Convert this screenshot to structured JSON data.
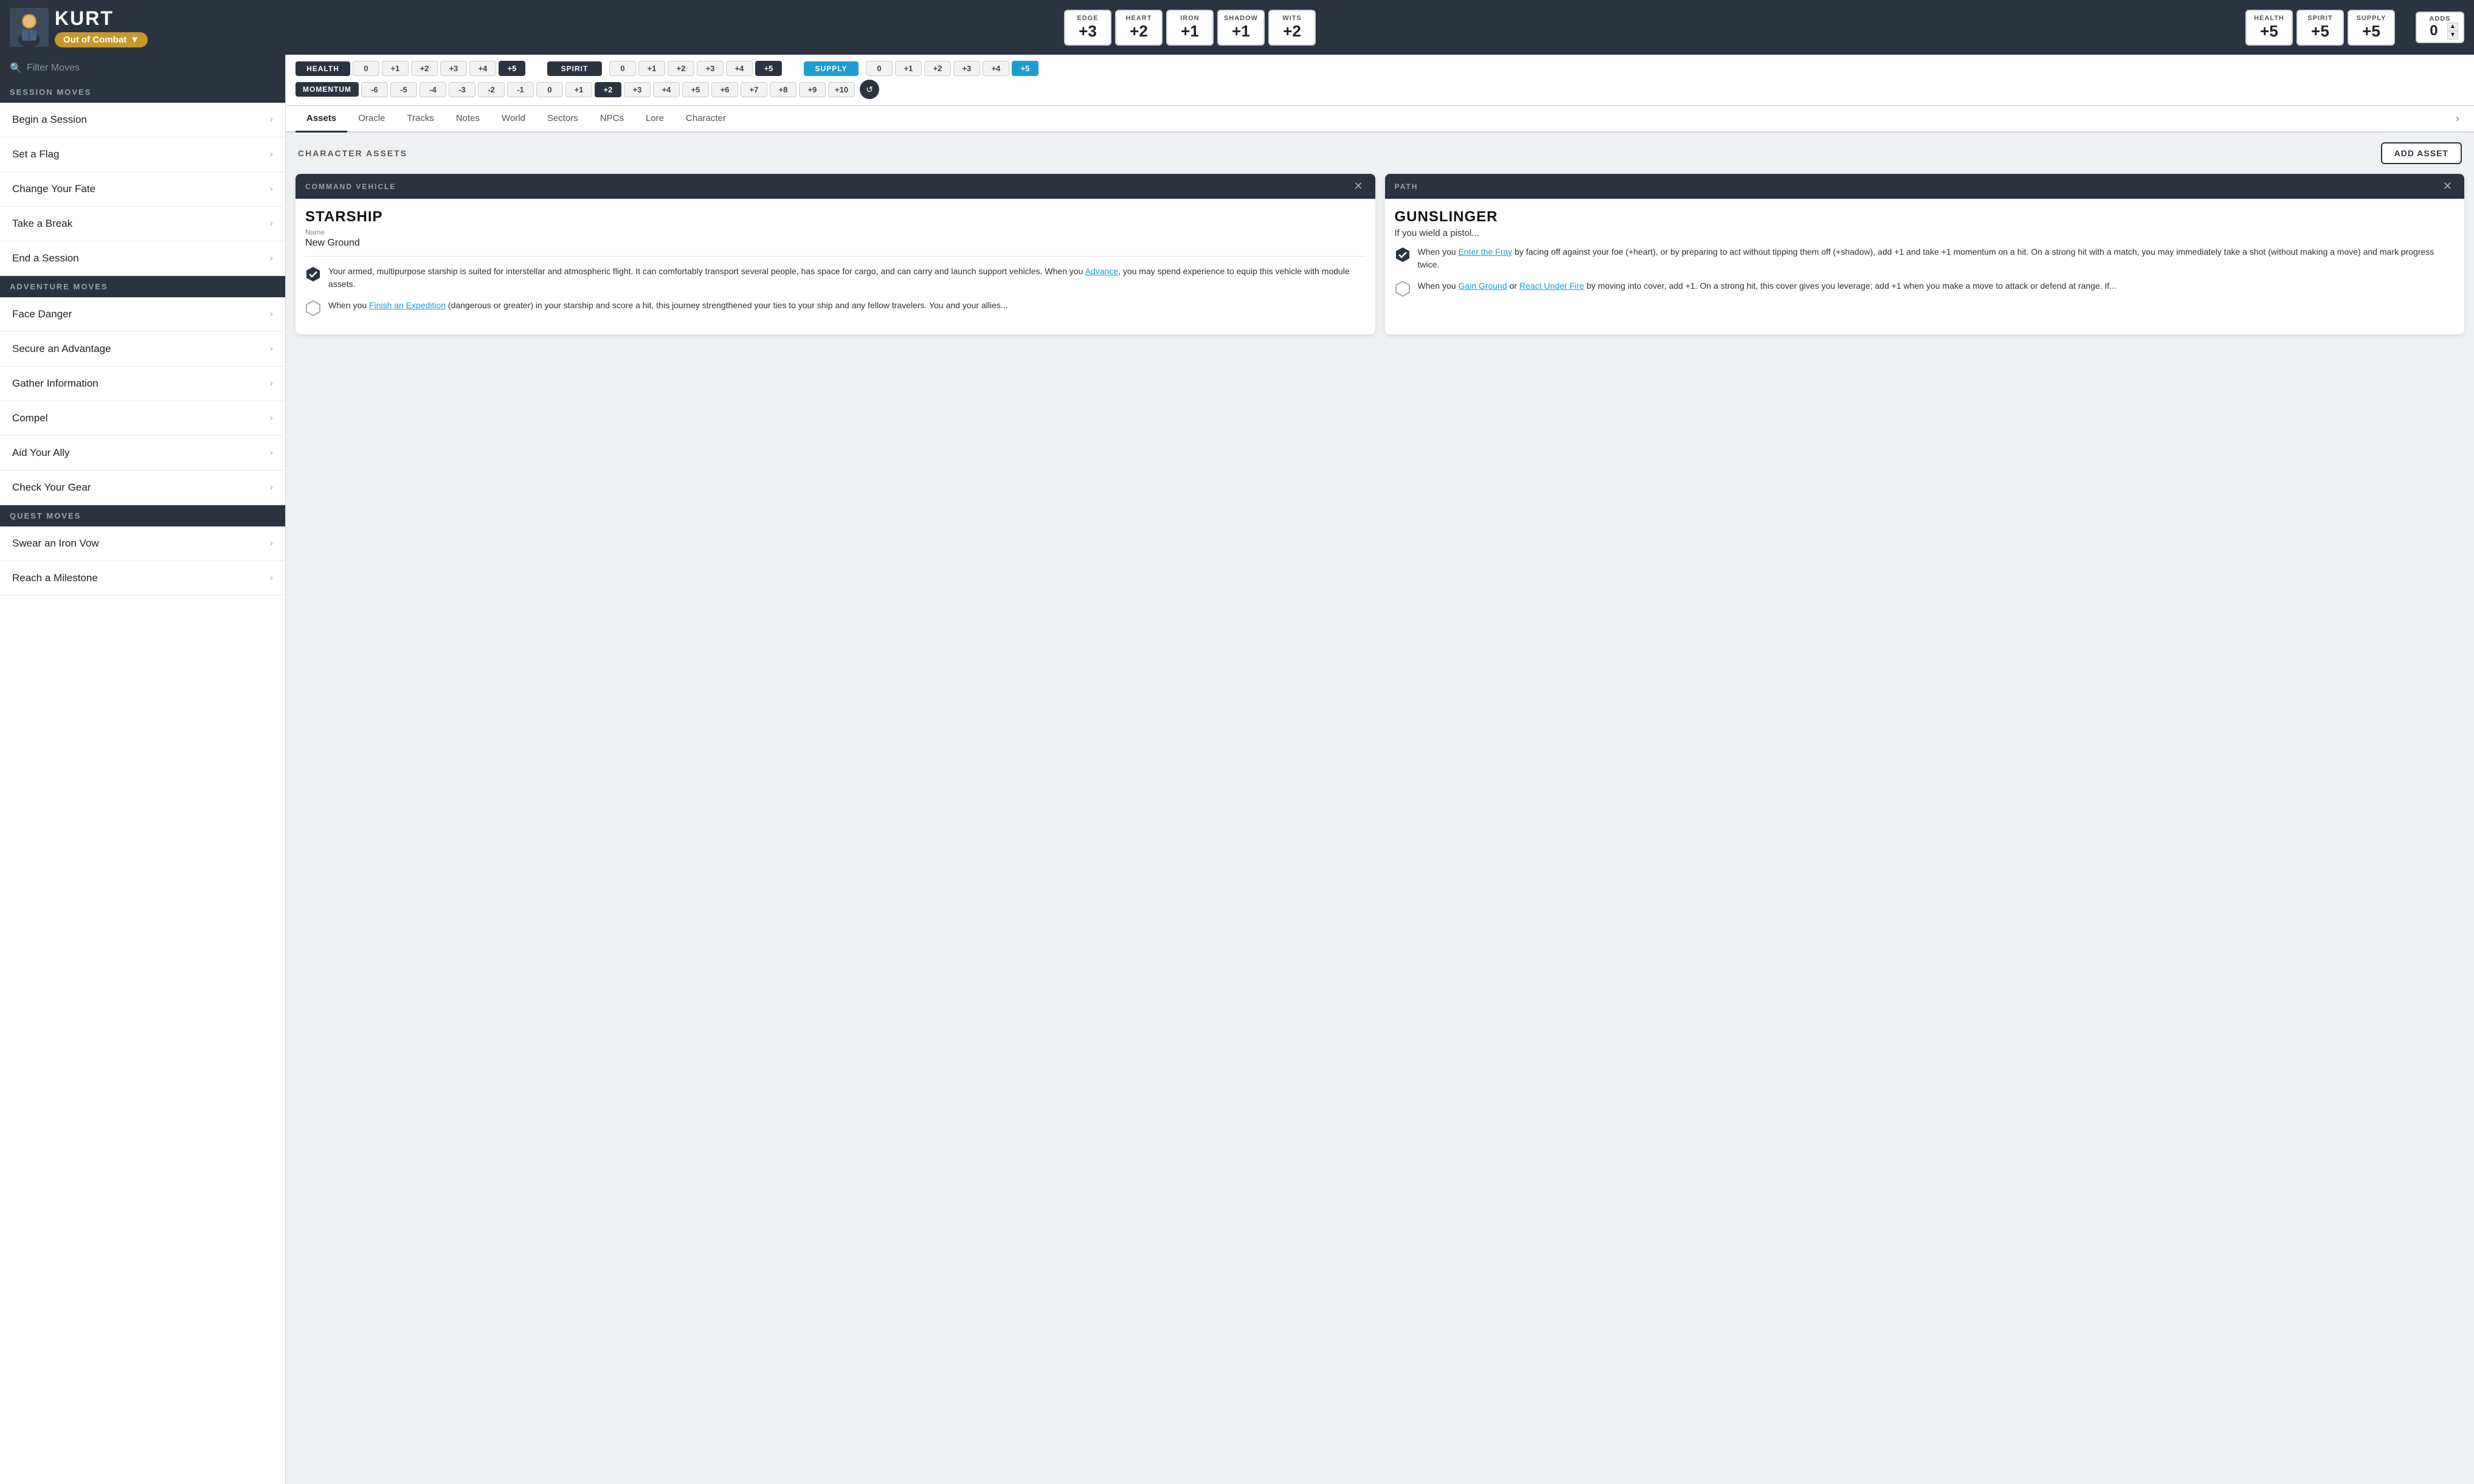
{
  "character": {
    "name": "KURT",
    "status": "Out of Combat",
    "avatar_label": "character-avatar"
  },
  "stats": [
    {
      "label": "EDGE",
      "value": "+3"
    },
    {
      "label": "HEART",
      "value": "+2"
    },
    {
      "label": "IRON",
      "value": "+1"
    },
    {
      "label": "SHADOW",
      "value": "+1"
    },
    {
      "label": "WITS",
      "value": "+2"
    }
  ],
  "conditions": [
    {
      "label": "HEALTH",
      "value": "+5"
    },
    {
      "label": "SPIRIT",
      "value": "+5"
    },
    {
      "label": "SUPPLY",
      "value": "+5"
    }
  ],
  "adds": {
    "label": "ADDS",
    "value": "0"
  },
  "trackers": {
    "health": {
      "label": "HEALTH",
      "values": [
        "0",
        "+1",
        "+2",
        "+3",
        "+4",
        "+5"
      ],
      "active": "+5"
    },
    "spirit": {
      "label": "SPIRIT",
      "values": [
        "0",
        "+1",
        "+2",
        "+3",
        "+4",
        "+5"
      ],
      "active": "+5"
    },
    "supply": {
      "label": "SUPPLY",
      "values": [
        "0",
        "+1",
        "+2",
        "+3",
        "+4",
        "+5"
      ],
      "active": "+5"
    },
    "momentum": {
      "label": "MOMENTUM",
      "values": [
        "-6",
        "-5",
        "-4",
        "-3",
        "-2",
        "-1",
        "0",
        "+1",
        "+2",
        "+3",
        "+4",
        "+5",
        "+6",
        "+7",
        "+8",
        "+9",
        "+10"
      ],
      "active": "+2"
    }
  },
  "tabs": [
    {
      "label": "Assets",
      "active": true
    },
    {
      "label": "Oracle"
    },
    {
      "label": "Tracks"
    },
    {
      "label": "Notes"
    },
    {
      "label": "World"
    },
    {
      "label": "Sectors"
    },
    {
      "label": "NPCs"
    },
    {
      "label": "Lore"
    },
    {
      "label": "Character"
    }
  ],
  "assets_section": {
    "title": "CHARACTER ASSETS",
    "add_button": "ADD ASSET"
  },
  "assets": [
    {
      "type": "COMMAND VEHICLE",
      "name": "STARSHIP",
      "subname_label": "Name",
      "subname": "New Ground",
      "abilities": [
        {
          "active": true,
          "text": "Your armed, multipurpose starship is suited for interstellar and atmospheric flight. It can comfortably transport several people, has space for cargo, and can carry and launch support vehicles. When you {Advance}, you may spend experience to equip this vehicle with module assets."
        },
        {
          "active": false,
          "text": "When you {Finish an Expedition} (dangerous or greater) in your starship and score a hit, this journey strengthened your ties to your ship and any fellow travelers. You and your allies..."
        }
      ],
      "links": [
        "Advance",
        "Finish an Expedition"
      ]
    },
    {
      "type": "PATH",
      "name": "GUNSLINGER",
      "subname_label": "",
      "subname": "",
      "intro": "If you wield a pistol...",
      "abilities": [
        {
          "active": true,
          "text": "When you {Enter the Fray} by facing off against your foe (+heart), or by preparing to act without tipping them off (+shadow), add +1 and take +1 momentum on a hit. On a strong hit with a match, you may immediately take a shot (without making a move) and mark progress twice."
        },
        {
          "active": false,
          "text": "When you {Gain Ground} or {React Under Fire} by moving into cover, add +1. On a strong hit, this cover gives you leverage; add +1 when you make a move to attack or defend at range. If..."
        }
      ],
      "links": [
        "Enter the Fray",
        "Gain Ground",
        "React Under Fire"
      ]
    }
  ],
  "sidebar": {
    "search_placeholder": "Filter Moves",
    "sections": [
      {
        "header": "SESSION MOVES",
        "moves": [
          "Begin a Session",
          "Set a Flag",
          "Change Your Fate",
          "Take a Break",
          "End a Session"
        ]
      },
      {
        "header": "ADVENTURE MOVES",
        "moves": [
          "Face Danger",
          "Secure an Advantage",
          "Gather Information",
          "Compel",
          "Aid Your Ally",
          "Check Your Gear"
        ]
      },
      {
        "header": "QUEST MOVES",
        "moves": [
          "Swear an Iron Vow",
          "Reach a Milestone"
        ]
      }
    ]
  }
}
